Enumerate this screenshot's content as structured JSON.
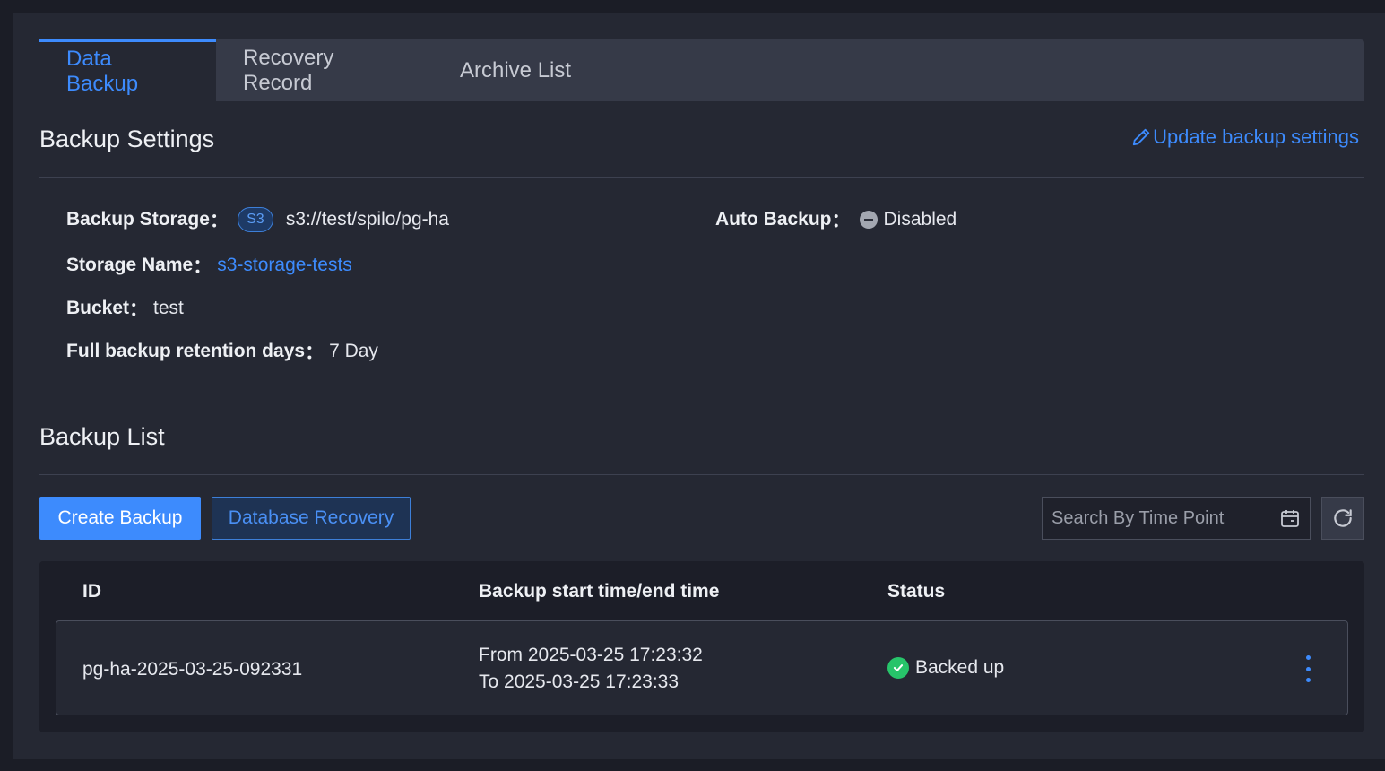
{
  "tabs": [
    "Data Backup",
    "Recovery Record",
    "Archive List"
  ],
  "settings": {
    "title": "Backup Settings",
    "update_label": "Update backup settings",
    "backup_storage_label": "Backup Storage",
    "storage_type_badge": "S3",
    "storage_path": "s3://test/spilo/pg-ha",
    "auto_backup_label": "Auto Backup",
    "auto_backup_value": "Disabled",
    "storage_name_label": "Storage Name",
    "storage_name_value": "s3-storage-tests",
    "bucket_label": "Bucket",
    "bucket_value": "test",
    "retention_label": "Full backup retention days",
    "retention_value": "7 Day",
    "separator": "："
  },
  "backup_list": {
    "title": "Backup List",
    "create_label": "Create Backup",
    "recovery_label": "Database Recovery",
    "search_placeholder": "Search By Time Point",
    "columns": [
      "ID",
      "Backup start time/end time",
      "Status"
    ],
    "rows": [
      {
        "id": "pg-ha-2025-03-25-092331",
        "from": "From 2025-03-25 17:23:32",
        "to": "To 2025-03-25 17:23:33",
        "status": "Backed up"
      }
    ]
  },
  "colors": {
    "accent": "#3d8bfd",
    "success": "#27c46a",
    "background": "#252833"
  },
  "icons": [
    "pencil-icon",
    "calendar-icon",
    "refresh-icon",
    "check-circle-icon",
    "disabled-icon",
    "more-vertical-icon"
  ]
}
